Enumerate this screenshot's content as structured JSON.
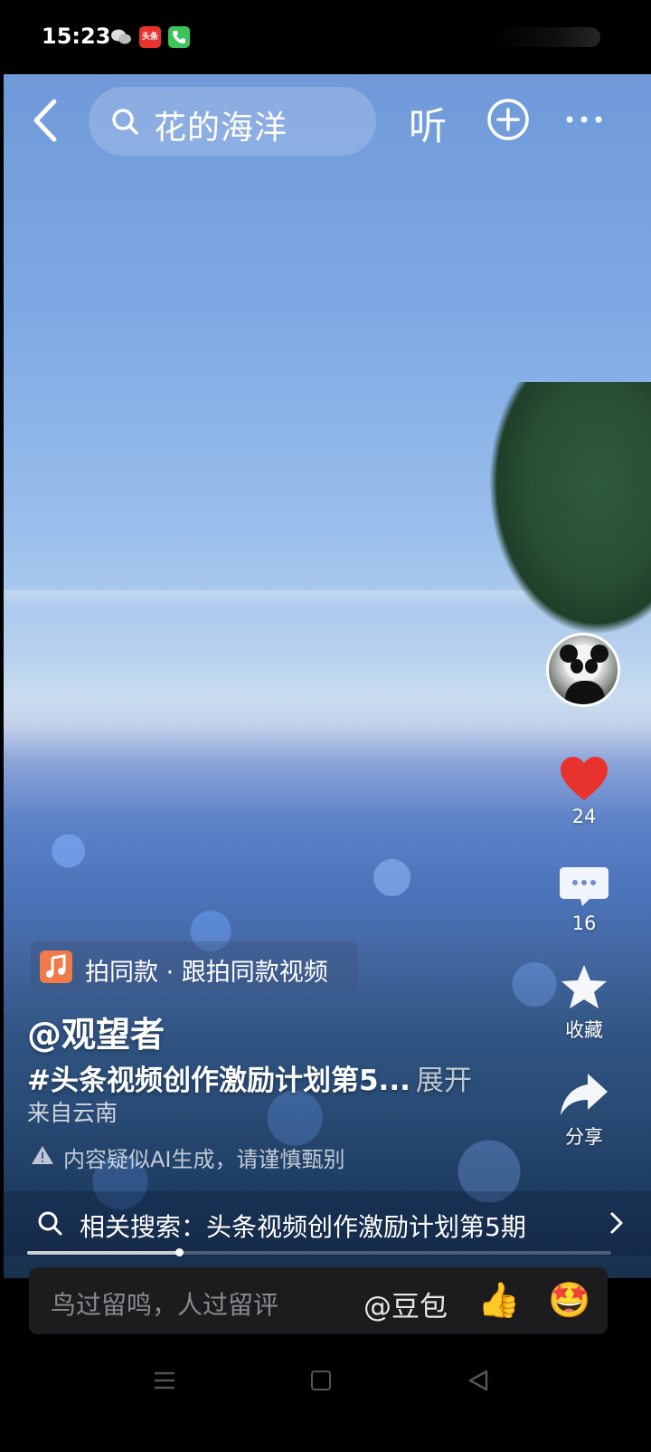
{
  "status_bar": {
    "time": "15:23",
    "app_badge": "头条"
  },
  "top_bar": {
    "search_text": "花的海洋",
    "listen_label": "听"
  },
  "rail": {
    "like_count": "24",
    "comment_count": "16",
    "favorite_label": "收藏",
    "share_label": "分享"
  },
  "caption": {
    "music": "拍同款 · 跟拍同款视频",
    "username": "@观望者",
    "description": "#头条视频创作激励计划第5...",
    "expand_label": "展开",
    "location": "来自云南",
    "ai_notice": "内容疑似AI生成，请谨慎甄别"
  },
  "related_search": {
    "text": "相关搜索：头条视频创作激励计划第5期"
  },
  "playback": {
    "progress": 0.26
  },
  "comment_bar": {
    "placeholder": "鸟过留鸣，人过留评",
    "mention": "@豆包",
    "emoji_1": "👍",
    "emoji_2": "🤩"
  },
  "colors": {
    "like": "#e8322d",
    "music_icon": "#f07a4a"
  }
}
